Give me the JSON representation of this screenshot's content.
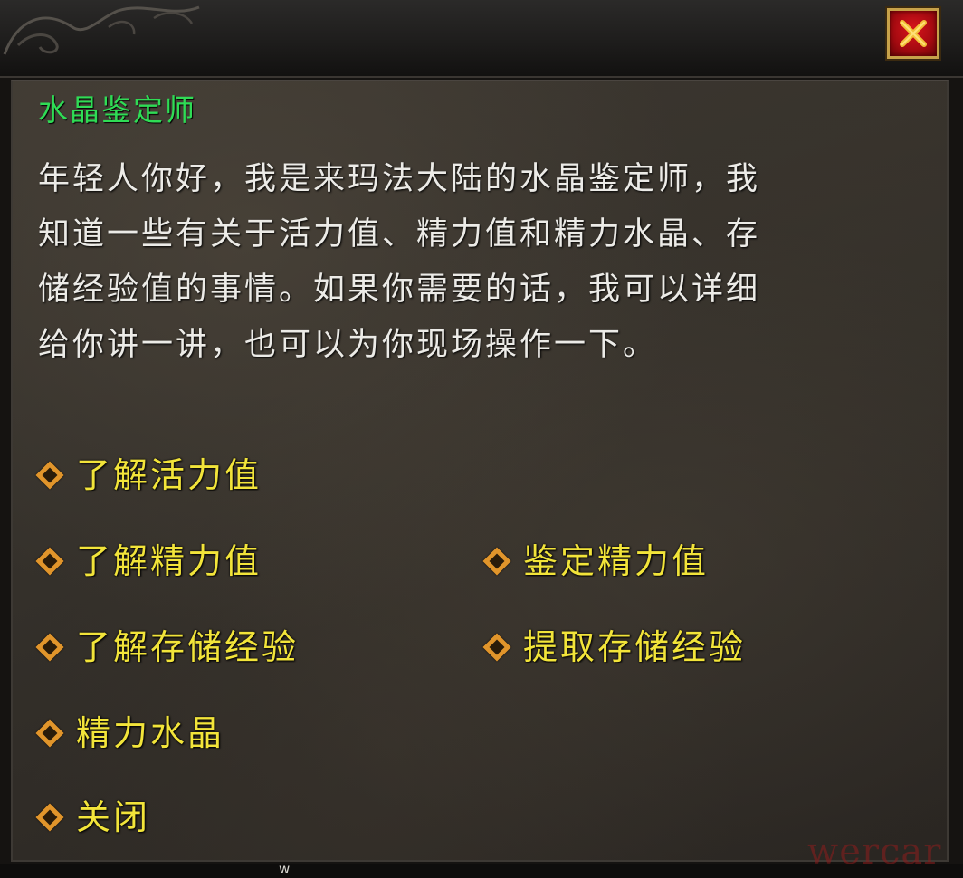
{
  "window": {
    "close_icon": "close-x-icon"
  },
  "npc": {
    "name": "水晶鉴定师"
  },
  "dialog": {
    "lines": [
      "年轻人你好，我是来玛法大陆的水晶鉴定师，我",
      "知道一些有关于活力值、精力值和精力水晶、存",
      "储经验值的事情。如果你需要的话，我可以详细",
      "给你讲一讲，也可以为你现场操作一下。"
    ]
  },
  "options": {
    "bullet_icon": "diamond-bullet-icon",
    "learn_vitality": "了解活力值",
    "learn_energy": "了解精力值",
    "appraise_energy": "鉴定精力值",
    "learn_stored_exp": "了解存储经验",
    "extract_stored_exp": "提取存储经验",
    "energy_crystal": "精力水晶",
    "close": "关闭"
  },
  "footer": {
    "mark": "w",
    "watermark": "wercar"
  },
  "colors": {
    "npc_name": "#2fdc55",
    "dialog_text": "#ecebe7",
    "option_text": "#f2e43a",
    "bullet": "#e1952b",
    "close_button": "#c4101a"
  }
}
